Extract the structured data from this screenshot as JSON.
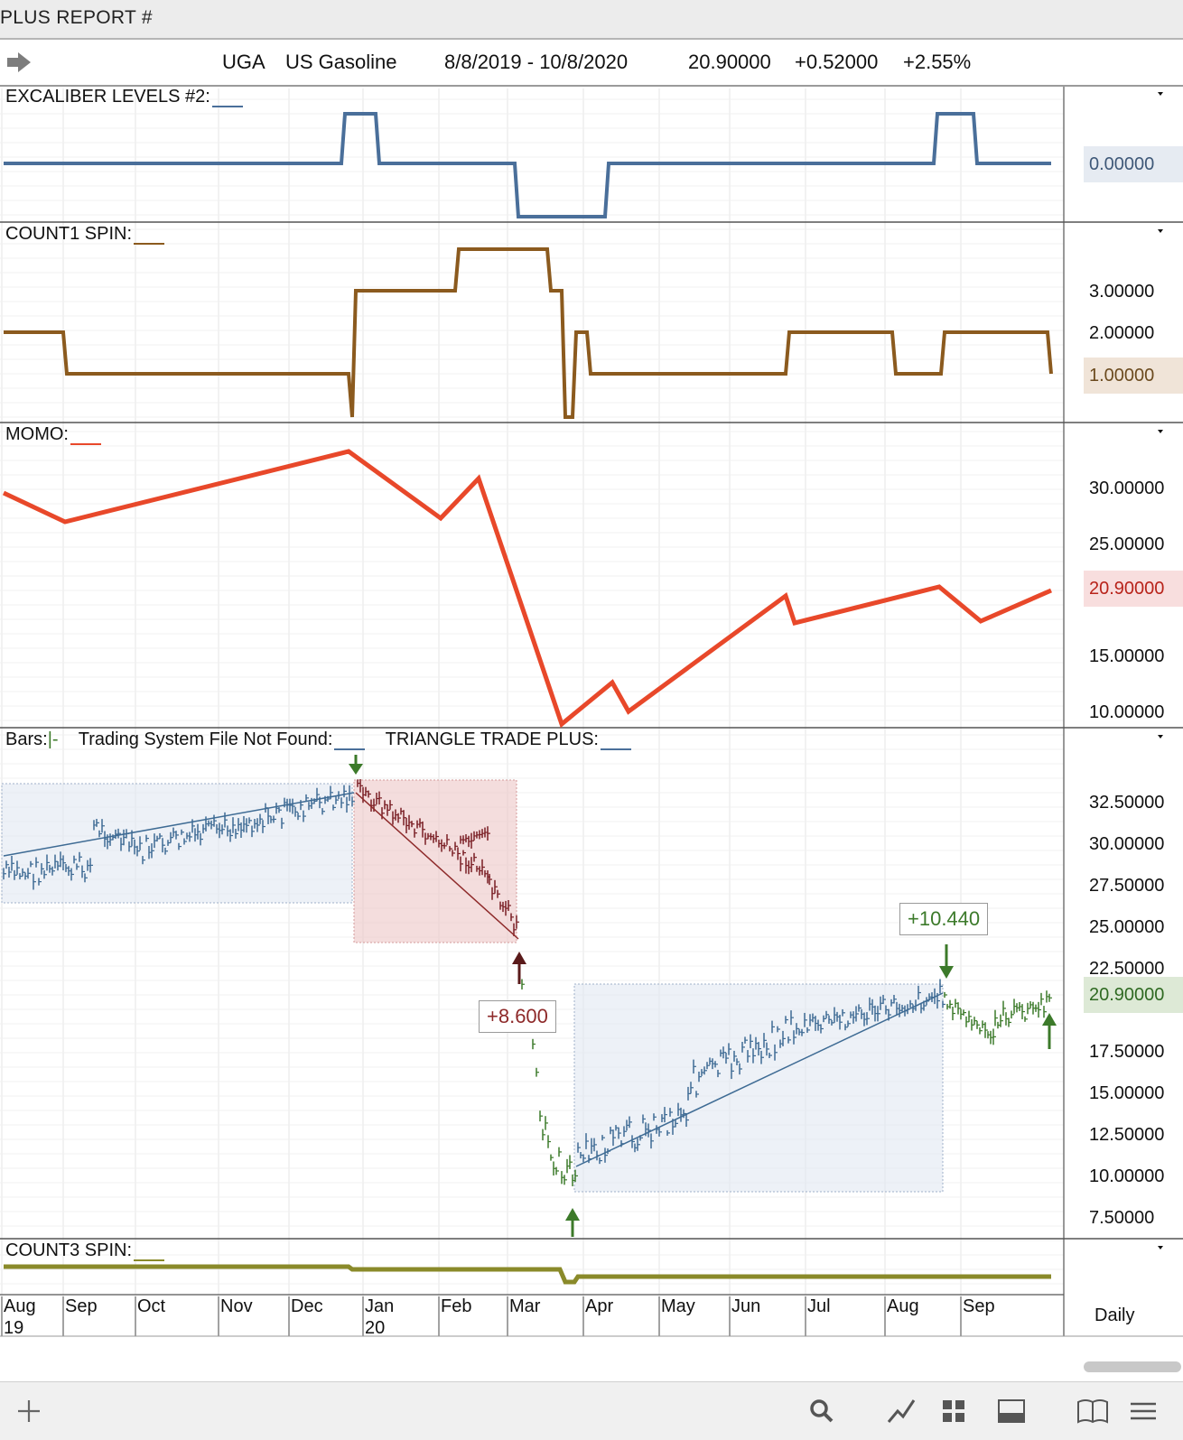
{
  "window": {
    "title": "PLUS REPORT #"
  },
  "quote": {
    "symbol": "UGA",
    "name": "US Gasoline",
    "range": "8/8/2019 - 10/8/2020",
    "last": "20.90000",
    "change": "+0.52000",
    "change_pct": "+2.55%"
  },
  "panels": {
    "excaliber": {
      "title": "EXCALIBER LEVELS #2:",
      "badge": "0.00000"
    },
    "count1": {
      "title": "COUNT1 SPIN:",
      "ticks": [
        "3.00000",
        "2.00000"
      ],
      "badge": "1.00000"
    },
    "momo": {
      "title": "MOMO:",
      "ticks": [
        "30.00000",
        "25.00000",
        "15.00000",
        "10.00000"
      ],
      "badge": "20.90000"
    },
    "bars": {
      "title_bars": "Bars:",
      "title_bars_mark": "|-",
      "title_system": "Trading System File Not Found:",
      "title_triangle": "TRIANGLE TRADE PLUS:",
      "ticks": [
        "32.50000",
        "30.00000",
        "27.50000",
        "25.00000",
        "22.50000",
        "17.50000",
        "15.00000",
        "12.50000",
        "10.00000",
        "7.50000"
      ],
      "badge": "20.90000",
      "trade_short": "+8.600",
      "trade_long": "+10.440"
    },
    "count3": {
      "title": "COUNT3 SPIN:"
    }
  },
  "timeaxis": {
    "months": [
      "Aug",
      "Sep",
      "Oct",
      "Nov",
      "Dec",
      "Jan",
      "Feb",
      "Mar",
      "Apr",
      "May",
      "Jun",
      "Jul",
      "Aug",
      "Sep"
    ],
    "years": [
      "19",
      "20"
    ],
    "period": "Daily"
  },
  "colors": {
    "excaliber_line": "#4a6f9a",
    "count1_line": "#8b5a1e",
    "momo_line": "#e8482a",
    "count3_line": "#8a8a2a",
    "bar_up_blue": "#3e6b94",
    "bar_down_red": "#7a1f25",
    "bar_green": "#3c7a2a"
  },
  "toolbar": {
    "icons": [
      "add-icon",
      "search-icon",
      "draw-line-icon",
      "layout-grid-icon",
      "panel-icon",
      "book-icon",
      "menu-icon"
    ]
  },
  "chart_data": [
    {
      "type": "line",
      "title": "EXCALIBER LEVELS #2",
      "x": [
        "Aug 19",
        "Dec 19",
        "Jan 20",
        "Mar 20",
        "Apr 20",
        "Aug 20",
        "Sep 20",
        "Oct 20"
      ],
      "series": [
        {
          "values": [
            0,
            0,
            1,
            -1,
            0,
            0,
            1,
            0
          ]
        }
      ],
      "last_value": 0.0
    },
    {
      "type": "line",
      "title": "COUNT1 SPIN",
      "ylim": [
        0,
        4
      ],
      "x": [
        "Aug 19",
        "Aug 19",
        "Dec 19",
        "Jan 20",
        "Feb 20",
        "Mar 20",
        "Apr 20",
        "Jun 20",
        "Aug 20",
        "Aug 20",
        "Oct 20"
      ],
      "series": [
        {
          "values": [
            2,
            1,
            1,
            3,
            4,
            3,
            2,
            1,
            2,
            1,
            2,
            1
          ]
        }
      ],
      "last_value": 1.0
    },
    {
      "type": "line",
      "title": "MOMO",
      "ylim": [
        9,
        34
      ],
      "x": [
        "Aug 19",
        "Sep 19",
        "Dec 19",
        "Feb 20",
        "Feb 20",
        "Mar 20",
        "Apr 20",
        "Apr 20",
        "Jun 20",
        "Jun 20",
        "Aug 20",
        "Sep 20",
        "Oct 20"
      ],
      "series": [
        {
          "values": [
            29.8,
            27.0,
            33.4,
            27.5,
            31.0,
            9.5,
            12.5,
            10.2,
            20.5,
            18.0,
            21.0,
            18.3,
            20.9
          ]
        }
      ],
      "last_value": 20.9
    },
    {
      "type": "bar",
      "title": "Bars",
      "ylim": [
        6.5,
        35.5
      ],
      "trades": [
        {
          "label": "+8.600",
          "entry": 33.5,
          "exit": 24.7,
          "direction": "short"
        },
        {
          "label": "+10.440",
          "entry": 10.4,
          "exit": 20.8,
          "direction": "long"
        }
      ],
      "last_value": 20.9
    },
    {
      "type": "line",
      "title": "COUNT3 SPIN",
      "x": [
        "Aug 19",
        "Dec 19",
        "Mar 20",
        "Apr 20",
        "Oct 20"
      ],
      "series": [
        {
          "values": [
            1,
            0.9,
            0.2,
            0.6,
            0.6
          ]
        }
      ]
    }
  ]
}
